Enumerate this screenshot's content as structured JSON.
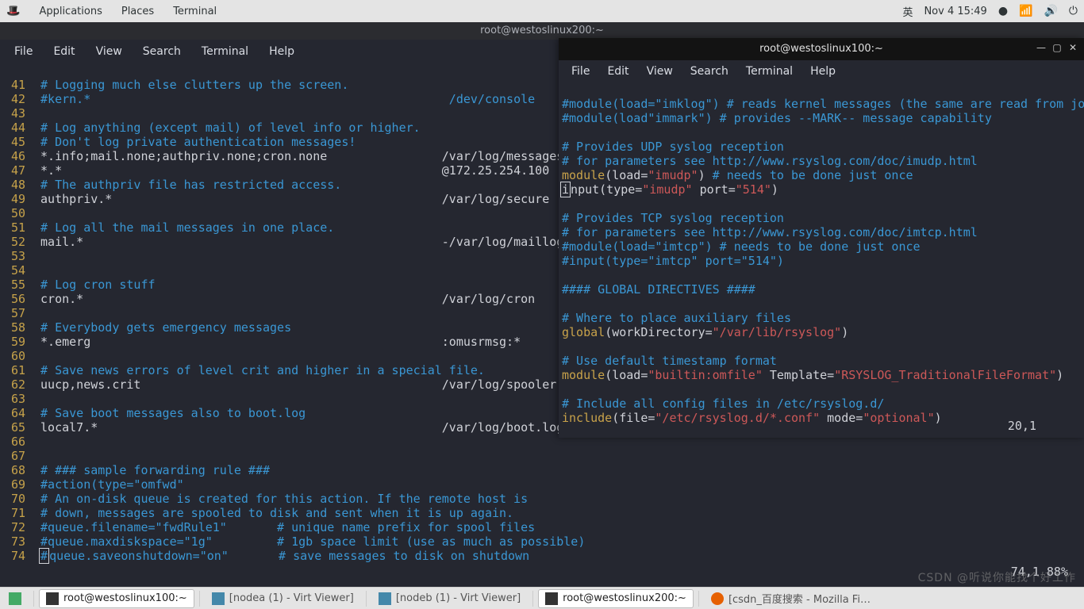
{
  "topbar": {
    "applications": "Applications",
    "places": "Places",
    "terminal": "Terminal",
    "im": "英",
    "clock": "Nov 4  15:49",
    "dot": "●"
  },
  "win1": {
    "title": "root@westoslinux200:~",
    "menu": {
      "file": "File",
      "edit": "Edit",
      "view": "View",
      "search": "Search",
      "terminal": "Terminal",
      "help": "Help"
    },
    "status": "74,1          88%",
    "lines": {
      "l41": "# Logging much else clutters up the screen.",
      "l42a": "#kern.*",
      "l42b": "/dev/console",
      "l44": "# Log anything (except mail) of level info or higher.",
      "l45": "# Don't log private authentication messages!",
      "l46a": "*.info;mail.none;authpriv.none;cron.none",
      "l46b": "/var/log/messages",
      "l47a": "*.*",
      "l47b": "@172.25.254.100",
      "l48": "# The authpriv file has restricted access.",
      "l49a": "authpriv.*",
      "l49b": "/var/log/secure",
      "l51": "# Log all the mail messages in one place.",
      "l52a": "mail.*",
      "l52b": "-/var/log/maillog",
      "l55": "# Log cron stuff",
      "l56a": "cron.*",
      "l56b": "/var/log/cron",
      "l58": "# Everybody gets emergency messages",
      "l59a": "*.emerg",
      "l59b": ":omusrmsg:*",
      "l61": "# Save news errors of level crit and higher in a special file.",
      "l62a": "uucp,news.crit",
      "l62b": "/var/log/spooler",
      "l64": "# Save boot messages also to boot.log",
      "l65a": "local7.*",
      "l65b": "/var/log/boot.log",
      "l68": "# ### sample forwarding rule ###",
      "l69": "#action(type=\"omfwd\"",
      "l70": "# An on-disk queue is created for this action. If the remote host is",
      "l71": "# down, messages are spooled to disk and sent when it is up again.",
      "l72": "#queue.filename=\"fwdRule1\"       # unique name prefix for spool files",
      "l73": "#queue.maxdiskspace=\"1g\"         # 1gb space limit (use as much as possible)",
      "l74a": "#",
      "l74b": "queue.saveonshutdown=\"on\"       # save messages to disk on shutdown"
    }
  },
  "win2": {
    "title": "root@westoslinux100:~",
    "menu": {
      "file": "File",
      "edit": "Edit",
      "view": "View",
      "search": "Search",
      "terminal": "Terminal",
      "help": "Help"
    },
    "status": "20,1",
    "l1": "#module(load=\"imklog\") # reads kernel messages (the same are read from jou",
    "l2": "#module(load\"immark\") # provides --MARK-- message capability",
    "l4": "# Provides UDP syslog reception",
    "l5": "# for parameters see http://www.rsyslog.com/doc/imudp.html",
    "l6a": "module",
    "l6b": "(load=",
    "l6c": "\"imudp\"",
    "l6d": ") ",
    "l6e": "# needs to be done just once",
    "l7a": "i",
    "l7b": "n",
    "l7c": "put(type=",
    "l7d": "\"imudp\"",
    "l7e": " port=",
    "l7f": "\"514\"",
    "l7g": ")",
    "l9": "# Provides TCP syslog reception",
    "l10": "# for parameters see http://www.rsyslog.com/doc/imtcp.html",
    "l11": "#module(load=\"imtcp\") # needs to be done just once",
    "l12": "#input(type=\"imtcp\" port=\"514\")",
    "l14": "#### GLOBAL DIRECTIVES ####",
    "l16": "# Where to place auxiliary files",
    "l17a": "global",
    "l17b": "(workDirectory=",
    "l17c": "\"/var/lib/rsyslog\"",
    "l17d": ")",
    "l19": "# Use default timestamp format",
    "l20a": "module",
    "l20b": "(load=",
    "l20c": "\"builtin:omfile\"",
    "l20d": " Template=",
    "l20e": "\"RSYSLOG_TraditionalFileFormat\"",
    "l20f": ")",
    "l22": "# Include all config files in /etc/rsyslog.d/",
    "l23a": "include",
    "l23b": "(file=",
    "l23c": "\"/etc/rsyslog.d/*.conf\"",
    "l23d": " mode=",
    "l23e": "\"optional\"",
    "l23f": ")"
  },
  "taskbar": {
    "t1": "root@westoslinux100:~",
    "t2": "[nodea (1) - Virt Viewer]",
    "t3": "[nodeb (1) - Virt Viewer]",
    "t4": "root@westoslinux200:~",
    "t5": "[csdn_百度搜索 - Mozilla Fi…"
  },
  "watermark": "CSDN @听说你能找个好工作"
}
